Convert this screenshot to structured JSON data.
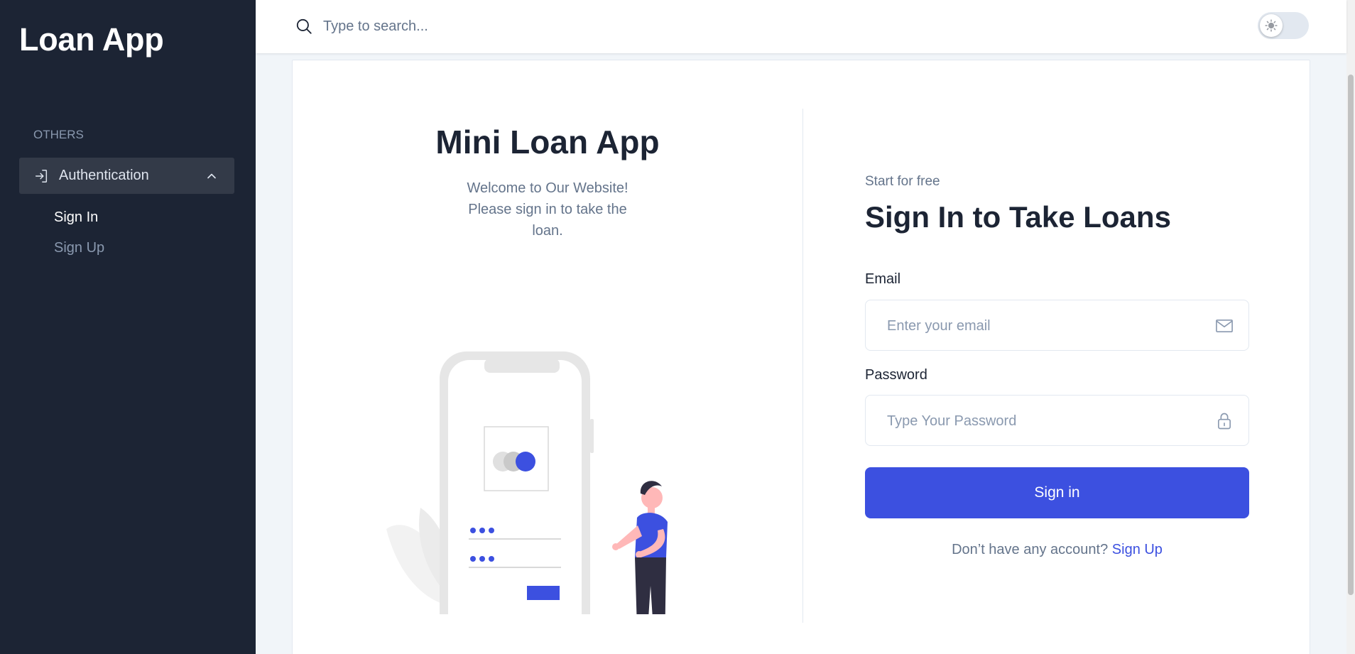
{
  "sidebar": {
    "brand": "Loan App",
    "section_label": "OTHERS",
    "group_label": "Authentication",
    "sub_items": [
      {
        "label": "Sign In",
        "active": true
      },
      {
        "label": "Sign Up",
        "active": false
      }
    ]
  },
  "header": {
    "search_placeholder": "Type to search...",
    "theme_mode": "light"
  },
  "intro": {
    "title": "Mini Loan App",
    "text": "Welcome to Our Website! Please sign in to take the loan."
  },
  "form": {
    "eyebrow": "Start for free",
    "title": "Sign In to Take Loans",
    "email_label": "Email",
    "email_placeholder": "Enter your email",
    "password_label": "Password",
    "password_placeholder": "Type Your Password",
    "submit_label": "Sign in",
    "footer_text": "Don’t have any account?",
    "footer_link": "Sign Up"
  },
  "colors": {
    "primary": "#3c50e0",
    "sidebar": "#1c2434",
    "sidebar_active": "#333a48",
    "text_muted": "#64748b"
  },
  "icons": [
    "login-icon",
    "chevron-up-icon",
    "search-icon",
    "sun-icon",
    "mail-icon",
    "lock-icon"
  ]
}
